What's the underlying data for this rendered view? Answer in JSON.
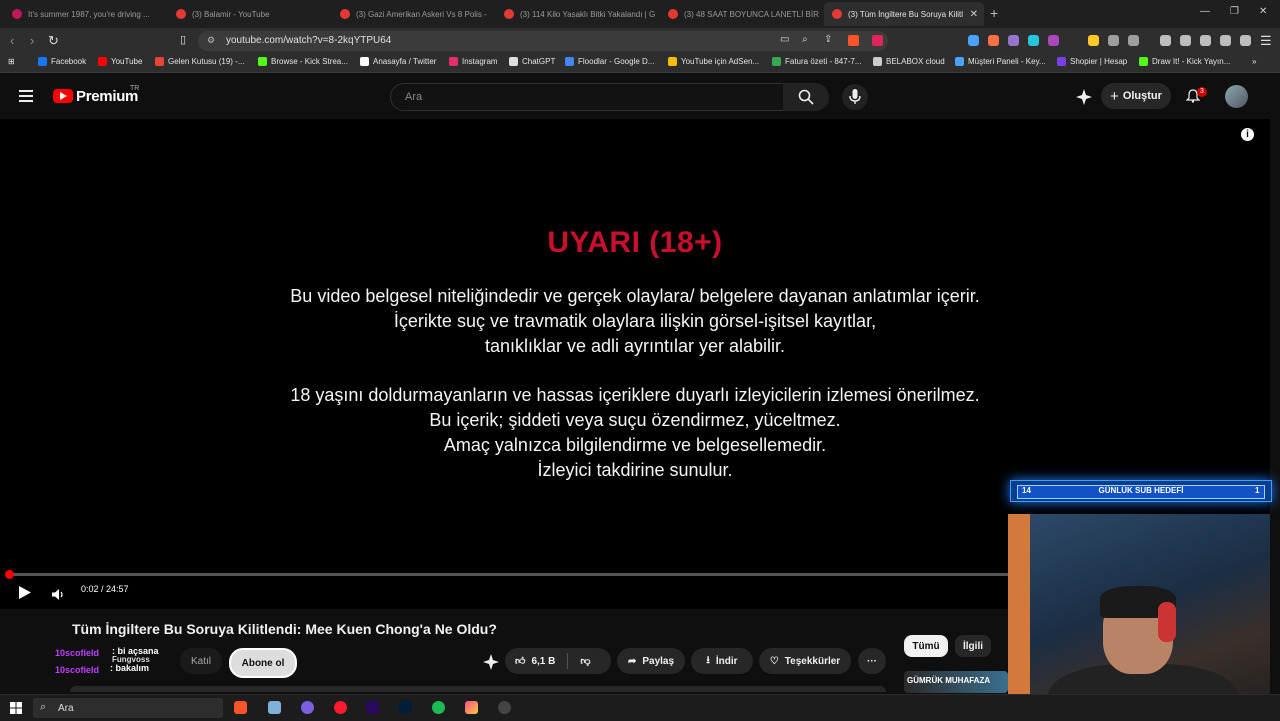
{
  "browser": {
    "tabs": [
      {
        "title": "It's summer 1987, you're driving ..."
      },
      {
        "title": "(3) Balamir - YouTube"
      },
      {
        "title": "(3) Gazi Amerikan Askeri Vs 8 Polis -"
      },
      {
        "title": "(3) 114 Kilo Yasaklı Bitki Yakalandı | G"
      },
      {
        "title": "(3) 48 SAAT BOYUNCA LANETLİ BİR"
      },
      {
        "title": "(3) Tüm İngiltere Bu Soruya Kilitl",
        "active": true
      }
    ],
    "url": "youtube.com/watch?v=8-2kqYTPU64",
    "bookmarks": [
      {
        "label": "Facebook",
        "color": "#1877f2"
      },
      {
        "label": "YouTube",
        "color": "#ff0000"
      },
      {
        "label": "Gelen Kutusu (19) -...",
        "color": "#ea4335"
      },
      {
        "label": "Browse - Kick Strea...",
        "color": "#53fc18"
      },
      {
        "label": "Anasayfa / Twitter",
        "color": "#ffffff"
      },
      {
        "label": "Instagram",
        "color": "#e1306c"
      },
      {
        "label": "ChatGPT",
        "color": "#dddddd"
      },
      {
        "label": "Floodlar - Google D...",
        "color": "#4285f4"
      },
      {
        "label": "YouTube için AdSen...",
        "color": "#fbbc04"
      },
      {
        "label": "Fatura özeti - 847-7...",
        "color": "#34a853"
      },
      {
        "label": "BELABOX cloud",
        "color": "#cccccc"
      },
      {
        "label": "Müşteri Paneli - Key...",
        "color": "#4aa3ff"
      },
      {
        "label": "Shopier | Hesap",
        "color": "#7b3fe4"
      },
      {
        "label": "Draw It! - Kick Yayın...",
        "color": "#53fc18"
      }
    ]
  },
  "youtube": {
    "brand": "Premium",
    "region": "TR",
    "search_placeholder": "Ara",
    "create_label": "Oluştur",
    "notifications_count": "3"
  },
  "player": {
    "warning_title": "UYARI (18+)",
    "warning_lines": [
      "Bu video belgesel niteliğindedir ve gerçek olaylara/ belgelere dayanan anlatımlar içerir.",
      "İçerikte suç ve travmatik olaylara ilişkin görsel-işitsel kayıtlar,",
      "tanıklıklar ve adli ayrıntılar yer alabilir.",
      "18 yaşını doldurmayanların ve hassas içeriklere duyarlı izleyicilerin izlemesi önerilmez.",
      "Bu içerik; şiddeti veya suçu özendirmez, yüceltmez.",
      "Amaç yalnızca bilgilendirme ve belgesellemedir.",
      "İzleyici takdirine sunulur."
    ],
    "time": "0:02 / 24:57",
    "progress": 0.0013
  },
  "overlay": {
    "sub_goal_label": "GÜNLÜK SUB HEDEFİ",
    "sub_goal_current": "14",
    "sub_goal_right": "1",
    "chat": [
      {
        "user": "10scofield",
        "message": ": bi açsana"
      },
      {
        "user": "10scofield",
        "message": ": bakalım"
      }
    ],
    "chat_overlay_name": "Fungvoss"
  },
  "video": {
    "title": "Tüm İngiltere Bu Soruya Kilitlendi: Mee Kuen Chong'a Ne Oldu?",
    "join_label": "Katıl",
    "subscribe_label": "Abone ol",
    "likes": "6,1 B",
    "share_label": "Paylaş",
    "download_label": "İndir",
    "thanks_label": "Teşekkürler"
  },
  "related": {
    "chips": [
      "Tümü",
      "İlgili"
    ],
    "thumb_text": "GÜMRÜK MUHAFAZA"
  },
  "taskbar": {
    "search_label": "Ara"
  }
}
